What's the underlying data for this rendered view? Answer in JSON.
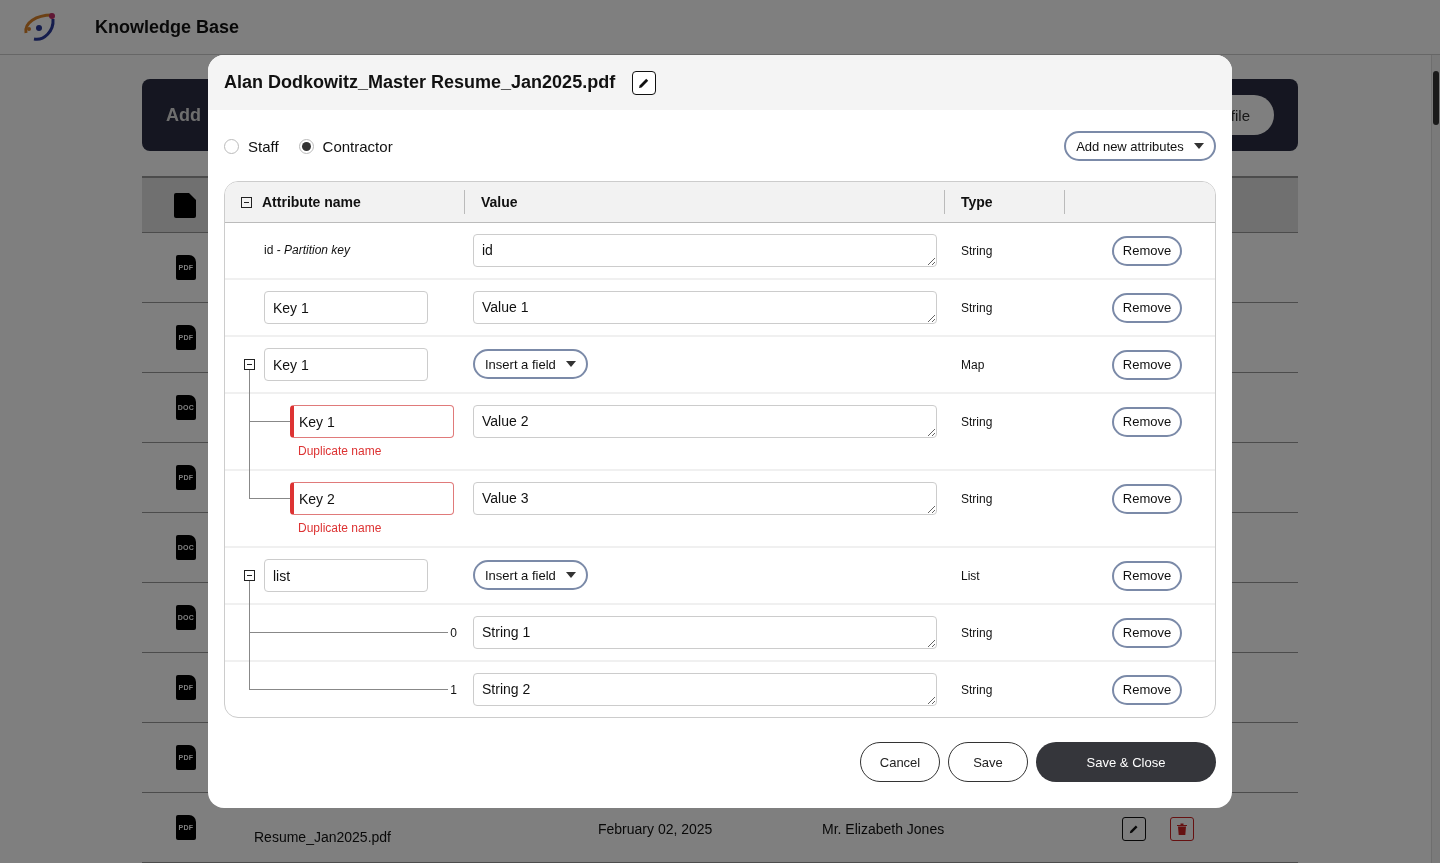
{
  "app": {
    "title": "Knowledge Base"
  },
  "toolbar": {
    "add_button": "Add",
    "file_button": "file"
  },
  "files": [
    {
      "type": "PDF"
    },
    {
      "type": "PDF"
    },
    {
      "type": "DOC"
    },
    {
      "type": "PDF"
    },
    {
      "type": "DOC"
    },
    {
      "type": "DOC"
    },
    {
      "type": "PDF"
    },
    {
      "type": "PDF"
    },
    {
      "type": "PDF",
      "name": "Resume_Jan2025.pdf",
      "date": "February 02, 2025",
      "owner": "Mr. Elizabeth Jones"
    }
  ],
  "dialog": {
    "title": "Alan Dodkowitz_Master Resume_Jan2025.pdf",
    "roles": [
      {
        "label": "Staff",
        "selected": false
      },
      {
        "label": "Contractor",
        "selected": true
      }
    ],
    "add_attributes": "Add new attributes",
    "columns": [
      "Attribute name",
      "Value",
      "Type"
    ],
    "rows": [
      {
        "kind": "key",
        "name": "id - *Partition key*",
        "value": "id",
        "type": "String",
        "action": "Remove"
      },
      {
        "kind": "field",
        "name": "Key 1",
        "value": "Value 1",
        "type": "String",
        "action": "Remove"
      },
      {
        "kind": "map",
        "name": "Key 1",
        "insert": "Insert a field",
        "type": "Map",
        "action": "Remove",
        "expanded": true,
        "children": [
          {
            "kind": "field",
            "name": "Key 1",
            "error": "Duplicate name",
            "value": "Value 2",
            "type": "String",
            "action": "Remove"
          },
          {
            "kind": "field",
            "name": "Key 2",
            "error": "Duplicate name",
            "value": "Value 3",
            "type": "String",
            "action": "Remove"
          }
        ]
      },
      {
        "kind": "list",
        "name": "list",
        "insert": "Insert a field",
        "type": "List",
        "action": "Remove",
        "expanded": true,
        "children": [
          {
            "kind": "item",
            "index": "0",
            "value": "String 1",
            "type": "String",
            "action": "Remove"
          },
          {
            "kind": "item",
            "index": "1",
            "value": "String 2",
            "type": "String",
            "action": "Remove"
          }
        ]
      }
    ],
    "buttons": [
      {
        "label": "Cancel",
        "kind": "outline"
      },
      {
        "label": "Save",
        "kind": "outline"
      },
      {
        "label": "Save & Close",
        "kind": "primary"
      }
    ]
  }
}
